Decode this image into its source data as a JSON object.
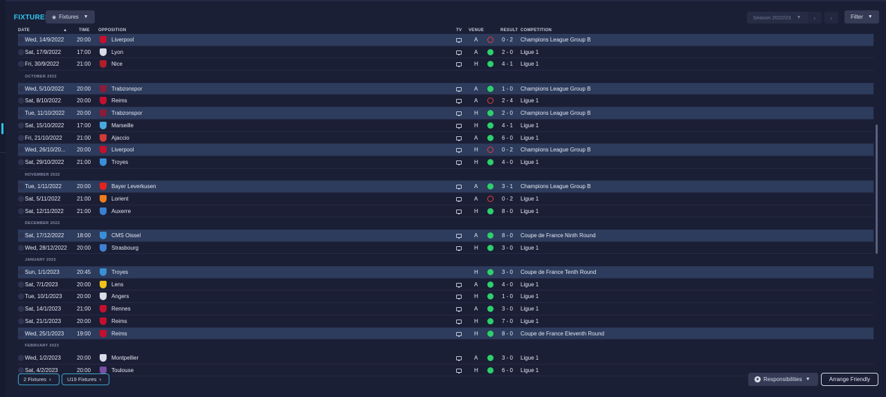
{
  "header": {
    "title": "FIXTURES",
    "view_dropdown": "Fixtures",
    "season": "Season 2022/23",
    "filter": "Filter"
  },
  "columns": {
    "date": "DATE",
    "time": "TIME",
    "opposition": "OPPOSITION",
    "tv": "TV",
    "venue": "VENUE",
    "result": "RESULT",
    "competition": "COMPETITION"
  },
  "colors": {
    "accent": "#2fc9ee",
    "win": "#2dd06b",
    "loss": "#ef3b3b",
    "highlight_row": "#2d3b5c"
  },
  "rows": [
    {
      "kind": "match",
      "hl": true,
      "date": "Wed, 14/9/2022",
      "time": "20:00",
      "opponent": "Liverpool",
      "crest": "#c8102e",
      "tv": true,
      "venue": "A",
      "outcome": "loss",
      "result": "0 - 2",
      "competition": "Champions League Group B"
    },
    {
      "kind": "match",
      "hl": false,
      "date": "Sat, 17/9/2022",
      "time": "17:00",
      "opponent": "Lyon",
      "crest": "#d9dce6",
      "tv": true,
      "venue": "A",
      "outcome": "win",
      "result": "2 - 0",
      "competition": "Ligue 1"
    },
    {
      "kind": "match",
      "hl": false,
      "date": "Fri, 30/9/2022",
      "time": "21:00",
      "opponent": "Nice",
      "crest": "#b01e2a",
      "tv": true,
      "venue": "H",
      "outcome": "win",
      "result": "4 - 1",
      "competition": "Ligue 1"
    },
    {
      "kind": "month",
      "label": "OCTOBER 2022"
    },
    {
      "kind": "match",
      "hl": true,
      "date": "Wed, 5/10/2022",
      "time": "20:00",
      "opponent": "Trabzonspor",
      "crest": "#8a1c3a",
      "tv": true,
      "venue": "A",
      "outcome": "win",
      "result": "1 - 0",
      "competition": "Champions League Group B"
    },
    {
      "kind": "match",
      "hl": false,
      "date": "Sat, 8/10/2022",
      "time": "20:00",
      "opponent": "Reims",
      "crest": "#c4102e",
      "tv": true,
      "venue": "A",
      "outcome": "loss",
      "result": "2 - 4",
      "competition": "Ligue 1"
    },
    {
      "kind": "match",
      "hl": true,
      "date": "Tue, 11/10/2022",
      "time": "20:00",
      "opponent": "Trabzonspor",
      "crest": "#8a1c3a",
      "tv": true,
      "venue": "H",
      "outcome": "win",
      "result": "2 - 0",
      "competition": "Champions League Group B"
    },
    {
      "kind": "match",
      "hl": false,
      "date": "Sat, 15/10/2022",
      "time": "17:00",
      "opponent": "Marseille",
      "crest": "#4aa7de",
      "tv": true,
      "venue": "H",
      "outcome": "win",
      "result": "4 - 1",
      "competition": "Ligue 1"
    },
    {
      "kind": "match",
      "hl": false,
      "date": "Fri, 21/10/2022",
      "time": "21:00",
      "opponent": "Ajaccio",
      "crest": "#d23a3a",
      "tv": true,
      "venue": "A",
      "outcome": "win",
      "result": "6 - 0",
      "competition": "Ligue 1"
    },
    {
      "kind": "match",
      "hl": true,
      "date": "Wed, 26/10/20...",
      "time": "20:00",
      "opponent": "Liverpool",
      "crest": "#c8102e",
      "tv": true,
      "venue": "H",
      "outcome": "loss",
      "result": "0 - 2",
      "competition": "Champions League Group B"
    },
    {
      "kind": "match",
      "hl": false,
      "date": "Sat, 29/10/2022",
      "time": "21:00",
      "opponent": "Troyes",
      "crest": "#3a8fd6",
      "tv": true,
      "venue": "H",
      "outcome": "win",
      "result": "4 - 0",
      "competition": "Ligue 1"
    },
    {
      "kind": "month",
      "label": "NOVEMBER 2022"
    },
    {
      "kind": "match",
      "hl": true,
      "date": "Tue, 1/11/2022",
      "time": "20:00",
      "opponent": "Bayer Leverkusen",
      "crest": "#e32221",
      "tv": true,
      "venue": "A",
      "outcome": "win",
      "result": "3 - 1",
      "competition": "Champions League Group B"
    },
    {
      "kind": "match",
      "hl": false,
      "date": "Sat, 5/11/2022",
      "time": "21:00",
      "opponent": "Lorient",
      "crest": "#f07d1b",
      "tv": true,
      "venue": "A",
      "outcome": "loss",
      "result": "0 - 2",
      "competition": "Ligue 1"
    },
    {
      "kind": "match",
      "hl": false,
      "date": "Sat, 12/11/2022",
      "time": "21:00",
      "opponent": "Auxerre",
      "crest": "#3b7fd0",
      "tv": true,
      "venue": "H",
      "outcome": "win",
      "result": "8 - 0",
      "competition": "Ligue 1"
    },
    {
      "kind": "month",
      "label": "DECEMBER 2022"
    },
    {
      "kind": "match",
      "hl": true,
      "date": "Sat, 17/12/2022",
      "time": "18:00",
      "opponent": "CMS Oissel",
      "crest": "#3a8fd6",
      "tv": true,
      "venue": "A",
      "outcome": "win",
      "result": "8 - 0",
      "competition": "Coupe de France Ninth Round"
    },
    {
      "kind": "match",
      "hl": false,
      "date": "Wed, 28/12/2022",
      "time": "20:00",
      "opponent": "Strasbourg",
      "crest": "#3f7fd4",
      "tv": true,
      "venue": "H",
      "outcome": "win",
      "result": "3 - 0",
      "competition": "Ligue 1"
    },
    {
      "kind": "month",
      "label": "JANUARY 2023"
    },
    {
      "kind": "match",
      "hl": true,
      "date": "Sun, 1/1/2023",
      "time": "20:45",
      "opponent": "Troyes",
      "crest": "#3a8fd6",
      "tv": false,
      "venue": "H",
      "outcome": "win",
      "result": "3 - 0",
      "competition": "Coupe de France Tenth Round"
    },
    {
      "kind": "match",
      "hl": false,
      "date": "Sat, 7/1/2023",
      "time": "20:00",
      "opponent": "Lens",
      "crest": "#f2c21b",
      "tv": true,
      "venue": "A",
      "outcome": "win",
      "result": "4 - 0",
      "competition": "Ligue 1"
    },
    {
      "kind": "match",
      "hl": false,
      "date": "Tue, 10/1/2023",
      "time": "20:00",
      "opponent": "Angers",
      "crest": "#d9dce6",
      "tv": true,
      "venue": "H",
      "outcome": "win",
      "result": "1 - 0",
      "competition": "Ligue 1"
    },
    {
      "kind": "match",
      "hl": false,
      "date": "Sat, 14/1/2023",
      "time": "21:00",
      "opponent": "Rennes",
      "crest": "#c4102e",
      "tv": true,
      "venue": "A",
      "outcome": "win",
      "result": "3 - 0",
      "competition": "Ligue 1"
    },
    {
      "kind": "match",
      "hl": false,
      "date": "Sat, 21/1/2023",
      "time": "20:00",
      "opponent": "Reims",
      "crest": "#c4102e",
      "tv": true,
      "venue": "H",
      "outcome": "win",
      "result": "7 - 0",
      "competition": "Ligue 1"
    },
    {
      "kind": "match",
      "hl": true,
      "date": "Wed, 25/1/2023",
      "time": "19:00",
      "opponent": "Reims",
      "crest": "#c4102e",
      "tv": true,
      "venue": "H",
      "outcome": "win",
      "result": "8 - 0",
      "competition": "Coupe de France Eleventh Round"
    },
    {
      "kind": "month",
      "label": "FEBRUARY 2023"
    },
    {
      "kind": "match",
      "hl": false,
      "date": "Wed, 1/2/2023",
      "time": "20:00",
      "opponent": "Montpellier",
      "crest": "#d9dce6",
      "tv": true,
      "venue": "A",
      "outcome": "win",
      "result": "3 - 0",
      "competition": "Ligue 1"
    },
    {
      "kind": "match",
      "hl": false,
      "date": "Sat, 4/2/2023",
      "time": "20:00",
      "opponent": "Toulouse",
      "crest": "#7b4fa6",
      "tv": true,
      "venue": "H",
      "outcome": "win",
      "result": "6 - 0",
      "competition": "Ligue 1"
    }
  ],
  "footer": {
    "fixtures_link": "2 Fixtures",
    "u19_link": "U19 Fixtures",
    "responsibilities": "Responsibilities",
    "arrange_friendly": "Arrange Friendly"
  }
}
